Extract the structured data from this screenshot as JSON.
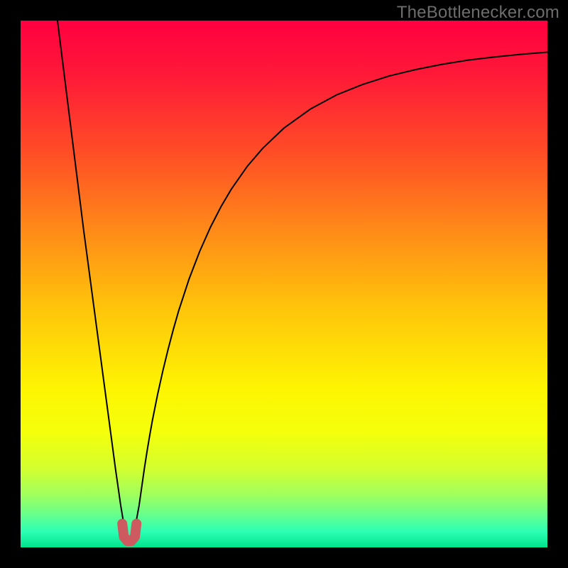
{
  "watermark": "TheBottlenecker.com",
  "chart_data": {
    "type": "line",
    "title": "",
    "xlabel": "",
    "ylabel": "",
    "xlim": [
      0,
      100
    ],
    "ylim": [
      0,
      100
    ],
    "background_gradient": {
      "stops": [
        {
          "offset": 0.0,
          "color": "#ff0040"
        },
        {
          "offset": 0.1,
          "color": "#ff1838"
        },
        {
          "offset": 0.25,
          "color": "#ff4d26"
        },
        {
          "offset": 0.4,
          "color": "#ff8b18"
        },
        {
          "offset": 0.55,
          "color": "#ffc60a"
        },
        {
          "offset": 0.7,
          "color": "#fdf502"
        },
        {
          "offset": 0.78,
          "color": "#f5ff0a"
        },
        {
          "offset": 0.85,
          "color": "#d3ff2e"
        },
        {
          "offset": 0.9,
          "color": "#a0ff5d"
        },
        {
          "offset": 0.94,
          "color": "#63ff8f"
        },
        {
          "offset": 0.97,
          "color": "#2cffb5"
        },
        {
          "offset": 1.0,
          "color": "#00e38c"
        }
      ]
    },
    "series": [
      {
        "name": "bottleneck-curve",
        "stroke": "#000000",
        "stroke_width": 2,
        "x": [
          7.0,
          8.0,
          9.0,
          10.0,
          11.0,
          12.0,
          13.0,
          14.0,
          15.0,
          16.0,
          17.0,
          18.0,
          18.5,
          19.0,
          19.5,
          20.0,
          20.5,
          21.0,
          21.5,
          22.5,
          23.0,
          23.5,
          24.0,
          24.5,
          25.0,
          26.0,
          27.0,
          28.0,
          29.0,
          30.0,
          32.0,
          34.0,
          36.0,
          38.0,
          40.0,
          43.0,
          46.0,
          50.0,
          55.0,
          60.0,
          65.0,
          70.0,
          75.0,
          80.0,
          85.0,
          90.0,
          95.0,
          100.0
        ],
        "y": [
          100.0,
          92.0,
          84.0,
          76.0,
          68.0,
          60.0,
          52.5,
          45.0,
          37.5,
          30.0,
          22.5,
          15.0,
          11.5,
          8.0,
          5.0,
          2.5,
          1.3,
          1.3,
          2.5,
          8.0,
          11.5,
          15.0,
          18.2,
          21.2,
          24.0,
          29.0,
          33.5,
          37.6,
          41.4,
          44.9,
          51.0,
          56.2,
          60.7,
          64.6,
          68.0,
          72.3,
          75.8,
          79.6,
          83.2,
          85.9,
          87.9,
          89.5,
          90.7,
          91.7,
          92.5,
          93.1,
          93.6,
          94.0
        ]
      }
    ],
    "marker": {
      "name": "optimum-marker",
      "stroke": "#cc5a5f",
      "stroke_width": 14,
      "points": [
        {
          "x": 19.3,
          "y": 4.5
        },
        {
          "x": 19.6,
          "y": 2.0
        },
        {
          "x": 20.3,
          "y": 1.2
        },
        {
          "x": 21.0,
          "y": 1.2
        },
        {
          "x": 21.7,
          "y": 2.0
        },
        {
          "x": 22.0,
          "y": 4.5
        }
      ]
    }
  }
}
